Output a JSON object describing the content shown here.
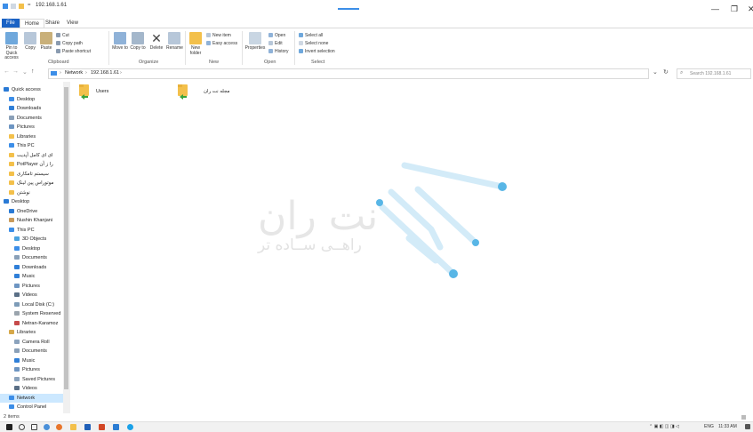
{
  "window": {
    "title": "192.168.1.61",
    "qa_sep": "=",
    "controls": {
      "minimize": "—",
      "maximize": "❐",
      "close": "✕"
    }
  },
  "ribbon_tabs": [
    {
      "label": "File"
    },
    {
      "label": "Home"
    },
    {
      "label": "Share"
    },
    {
      "label": "View"
    }
  ],
  "ribbon": {
    "clipboard": {
      "pin_label": "Pin to Quick access",
      "copy_label": "Copy",
      "paste_label": "Paste",
      "cut_label": "Cut",
      "copy_path_label": "Copy path",
      "paste_shortcut_label": "Paste shortcut",
      "group_label": "Clipboard"
    },
    "organize": {
      "move_to_label": "Move to",
      "copy_to_label": "Copy to",
      "delete_label": "Delete",
      "rename_label": "Rename",
      "group_label": "Organize"
    },
    "new": {
      "new_folder_label": "New folder",
      "new_item_label": "New item",
      "easy_access_label": "Easy access",
      "group_label": "New"
    },
    "open": {
      "properties_label": "Properties",
      "open_label": "Open",
      "edit_label": "Edit",
      "history_label": "History",
      "group_label": "Open"
    },
    "select": {
      "select_all_label": "Select all",
      "select_none_label": "Select none",
      "invert_label": "Invert selection",
      "group_label": "Select"
    }
  },
  "address": {
    "crumbs": [
      "Network",
      "192.168.1.61"
    ],
    "separator": "›",
    "search_placeholder": "Search 192.168.1.61",
    "refresh_glyph": "↻",
    "dropdown_glyph": "⌄",
    "search_glyph": "⌕",
    "nav": {
      "back": "←",
      "forward": "→",
      "recent": "⌄",
      "up": "↑"
    }
  },
  "sidebar": {
    "items": [
      {
        "label": "Quick access",
        "icon": "star-icon",
        "color": "#2a7ad5",
        "pinned": false,
        "indent": 0
      },
      {
        "label": "Desktop",
        "icon": "desktop-icon",
        "color": "#3c8ee8",
        "pinned": true,
        "indent": 1
      },
      {
        "label": "Downloads",
        "icon": "download-icon",
        "color": "#2f7fd8",
        "pinned": true,
        "indent": 1
      },
      {
        "label": "Documents",
        "icon": "documents-icon",
        "color": "#8aa0b8",
        "pinned": true,
        "indent": 1
      },
      {
        "label": "Pictures",
        "icon": "pictures-icon",
        "color": "#6d95c2",
        "pinned": true,
        "indent": 1
      },
      {
        "label": "Libraries",
        "icon": "folder-icon",
        "color": "#f3c04b",
        "pinned": true,
        "indent": 1
      },
      {
        "label": "This PC",
        "icon": "pc-icon",
        "color": "#3c8ee8",
        "pinned": true,
        "indent": 1
      },
      {
        "label": "ای ای کامل آپدیت",
        "icon": "folder-icon",
        "color": "#f3c04b",
        "pinned": false,
        "indent": 1
      },
      {
        "label": "PotPlayer را ز آن",
        "icon": "folder-icon",
        "color": "#f3c04b",
        "pinned": false,
        "indent": 1
      },
      {
        "label": "سیستم تامکاری",
        "icon": "folder-icon",
        "color": "#f3c04b",
        "pinned": false,
        "indent": 1
      },
      {
        "label": "موتوراس پین لینک",
        "icon": "folder-icon",
        "color": "#f3c04b",
        "pinned": false,
        "indent": 1
      },
      {
        "label": "نوشتن",
        "icon": "folder-icon",
        "color": "#f3c04b",
        "pinned": false,
        "indent": 1
      },
      {
        "label": "Desktop",
        "icon": "desktop-icon",
        "color": "#2a7ad5",
        "pinned": false,
        "indent": 0
      },
      {
        "label": "OneDrive",
        "icon": "cloud-icon",
        "color": "#2a7ad5",
        "pinned": false,
        "indent": 1
      },
      {
        "label": "Nushin Khanjani",
        "icon": "user-icon",
        "color": "#c99a5b",
        "pinned": false,
        "indent": 1
      },
      {
        "label": "This PC",
        "icon": "pc-icon",
        "color": "#3c8ee8",
        "pinned": false,
        "indent": 1
      },
      {
        "label": "3D Objects",
        "icon": "cube-icon",
        "color": "#4aa3e0",
        "pinned": false,
        "indent": 2
      },
      {
        "label": "Desktop",
        "icon": "desktop-icon",
        "color": "#3c8ee8",
        "pinned": false,
        "indent": 2
      },
      {
        "label": "Documents",
        "icon": "documents-icon",
        "color": "#8aa0b8",
        "pinned": false,
        "indent": 2
      },
      {
        "label": "Downloads",
        "icon": "download-icon",
        "color": "#2f7fd8",
        "pinned": false,
        "indent": 2
      },
      {
        "label": "Music",
        "icon": "music-icon",
        "color": "#2f7fd8",
        "pinned": false,
        "indent": 2
      },
      {
        "label": "Pictures",
        "icon": "pictures-icon",
        "color": "#6d95c2",
        "pinned": false,
        "indent": 2
      },
      {
        "label": "Videos",
        "icon": "video-icon",
        "color": "#5a6f86",
        "pinned": false,
        "indent": 2
      },
      {
        "label": "Local Disk (C:)",
        "icon": "disk-icon",
        "color": "#7d9bb7",
        "pinned": false,
        "indent": 2
      },
      {
        "label": "System Reserved",
        "icon": "disk-icon",
        "color": "#9aa4ad",
        "pinned": false,
        "indent": 2
      },
      {
        "label": "Netran-Karamoz",
        "icon": "network-drive-icon",
        "color": "#c64a4a",
        "pinned": false,
        "indent": 2
      },
      {
        "label": "Libraries",
        "icon": "libraries-icon",
        "color": "#d6a84a",
        "pinned": false,
        "indent": 1
      },
      {
        "label": "Camera Roll",
        "icon": "pictures-icon",
        "color": "#8ba3bd",
        "pinned": false,
        "indent": 2
      },
      {
        "label": "Documents",
        "icon": "documents-icon",
        "color": "#8aa0b8",
        "pinned": false,
        "indent": 2
      },
      {
        "label": "Music",
        "icon": "music-icon",
        "color": "#2f7fd8",
        "pinned": false,
        "indent": 2
      },
      {
        "label": "Pictures",
        "icon": "pictures-icon",
        "color": "#6d95c2",
        "pinned": false,
        "indent": 2
      },
      {
        "label": "Saved Pictures",
        "icon": "pictures-icon",
        "color": "#8ba3bd",
        "pinned": false,
        "indent": 2
      },
      {
        "label": "Videos",
        "icon": "video-icon",
        "color": "#5a6f86",
        "pinned": false,
        "indent": 2
      },
      {
        "label": "Network",
        "icon": "network-icon",
        "color": "#3c8ee8",
        "pinned": false,
        "indent": 1,
        "selected": true
      },
      {
        "label": "Control Panel",
        "icon": "control-panel-icon",
        "color": "#3c8ee8",
        "pinned": false,
        "indent": 1
      }
    ],
    "pin_glyph": "✱"
  },
  "content": {
    "items": [
      {
        "label": "Users",
        "icon": "shared-folder-icon"
      },
      {
        "label": "مجله نت ران",
        "icon": "shared-folder-icon"
      }
    ]
  },
  "watermark": {
    "brand": "نت ران",
    "slogan": "راهــی ســاده تر"
  },
  "status": {
    "count": "2 items"
  },
  "taskbar": {
    "lang": "ENG",
    "time": "11:33 AM",
    "tray_glyphs": "⌃ ▣ ◧ ◫ ◨ ◁"
  },
  "colors": {
    "file_tab": "#1a62c4",
    "folder": "#f3c04b",
    "share_arrow": "#3aa33a",
    "selected": "#cce8ff",
    "watermark_logo": "#58b6e6"
  }
}
